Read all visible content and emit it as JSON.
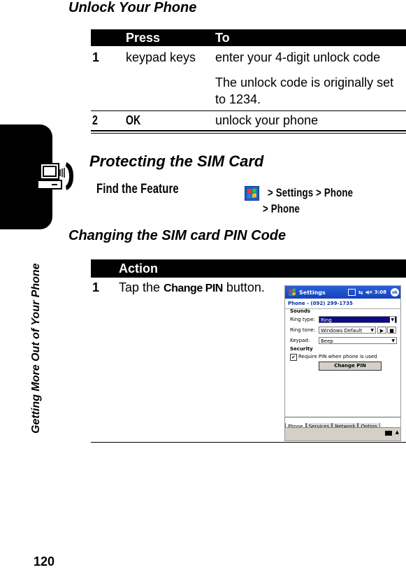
{
  "page": {
    "number": "120",
    "side_tab_label": "Getting More Out of Your Phone",
    "side_tab_icon": "computer-phone-icon"
  },
  "unlock": {
    "heading": "Unlock Your Phone",
    "columns": [
      "",
      "Press",
      "To"
    ],
    "rows": [
      {
        "step": "1",
        "press": "keypad keys",
        "to": "enter your 4-digit unlock code",
        "note": "The unlock code is originally set to 1234."
      },
      {
        "step": "2",
        "press": "OK",
        "to": "unlock your phone"
      }
    ]
  },
  "sim": {
    "heading": "Protecting the SIM Card",
    "find_feature_label": "Find the Feature",
    "path_icon": "windows-start-icon",
    "path_line1": "> Settings > Phone",
    "path_line2": "> Phone"
  },
  "pin": {
    "heading": "Changing the SIM card PIN Code",
    "column": "Action",
    "step": "1",
    "action_pre": "Tap the ",
    "action_key": "Change PIN",
    "action_post": " button."
  },
  "device": {
    "title": "Settings",
    "clock": "3:08",
    "ok_label": "ok",
    "subtitle": "Phone - (092) 299-1735",
    "sounds_label": "Sounds",
    "ring_type_label": "Ring type:",
    "ring_type_value": "Ring",
    "ring_tone_label": "Ring tone:",
    "ring_tone_value": "Windows Default",
    "keypad_label": "Keypad:",
    "keypad_value": "Beep",
    "security_label": "Security",
    "require_pin_label": "Require PIN when phone is used",
    "require_pin_checked": true,
    "change_pin_button": "Change PIN",
    "tabs": [
      "Phone",
      "Services",
      "Network",
      "Option"
    ],
    "active_tab": "Phone",
    "colors": {
      "title_bar": "#1d4fc4",
      "selected_field": "#0a0a8a",
      "button_face": "#d4d0c8"
    }
  }
}
